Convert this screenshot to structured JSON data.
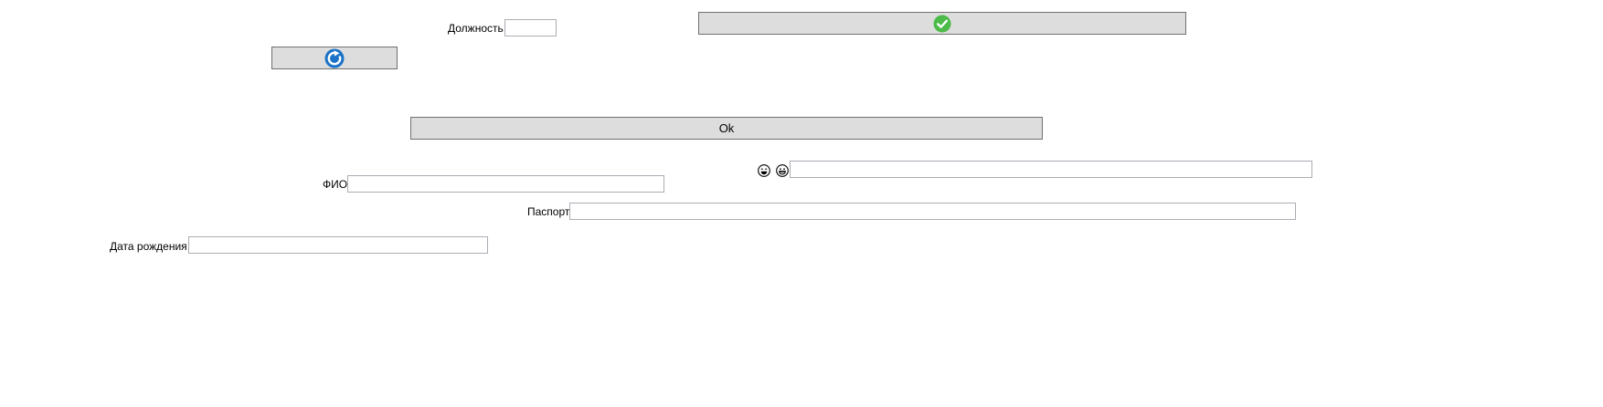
{
  "form": {
    "position_label": "Должность",
    "position_value": "",
    "fio_label": "ФИО",
    "fio_value": "",
    "passport_label": "Паспорт",
    "passport_value": "",
    "birthdate_label": "Дата рождения",
    "birthdate_value": "",
    "extra_value": ""
  },
  "buttons": {
    "confirm_icon": "green-check-circle-icon",
    "refresh_icon": "blue-refresh-icon",
    "ok_label": "Ok"
  },
  "icons": {
    "emoji_one": "laughing-face-icon",
    "emoji_two": "grinning-face-icon"
  },
  "colors": {
    "button_bg": "#dddddd",
    "button_border": "#707070",
    "field_border": "#abadb3",
    "check_green": "#4cbb47",
    "refresh_blue": "#1a73c8"
  }
}
